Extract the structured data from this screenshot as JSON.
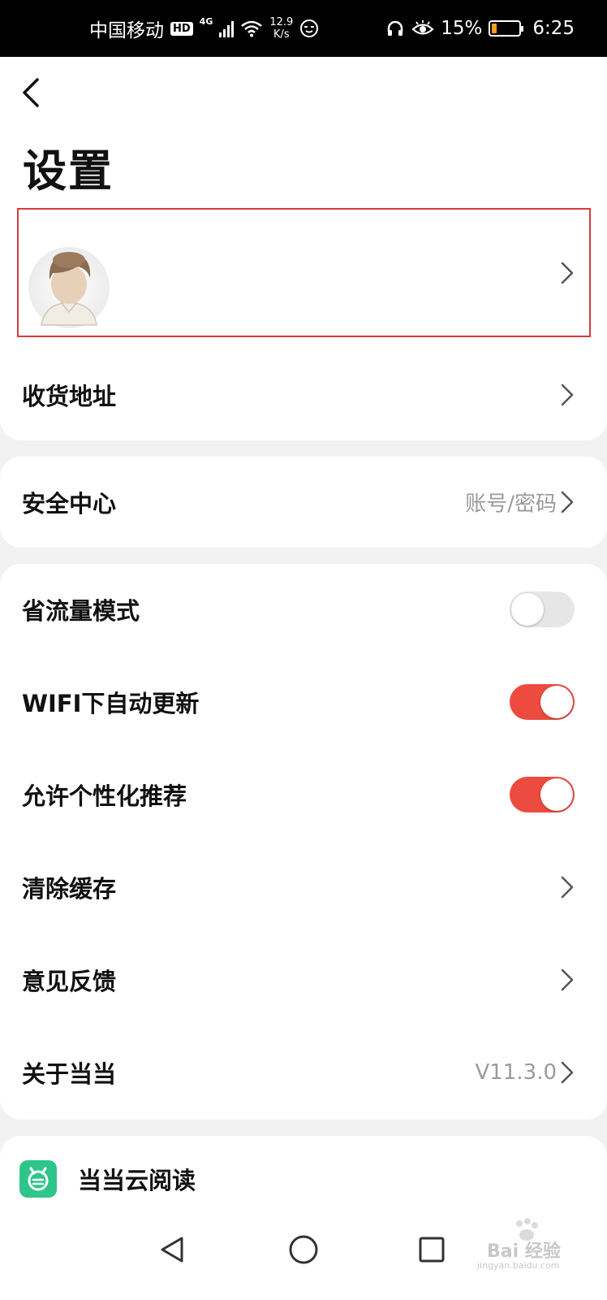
{
  "status_bar": {
    "carrier": "中国移动",
    "hd": "HD",
    "network": "4G",
    "speed_value": "12.9",
    "speed_unit": "K/s",
    "battery": "15%",
    "time": "6:25"
  },
  "header": {
    "title": "设置"
  },
  "rows": {
    "address": {
      "label": "收货地址"
    },
    "security": {
      "label": "安全中心",
      "value": "账号/密码"
    },
    "data_saver": {
      "label": "省流量模式",
      "enabled": false
    },
    "wifi_update": {
      "label": "WIFI下自动更新",
      "enabled": true
    },
    "personalized": {
      "label": "允许个性化推荐",
      "enabled": true
    },
    "clear_cache": {
      "label": "清除缓存"
    },
    "feedback": {
      "label": "意见反馈"
    },
    "about": {
      "label": "关于当当",
      "value": "V11.3.0"
    }
  },
  "app_promo": {
    "label": "当当云阅读",
    "icon_color": "#2ec58a"
  },
  "colors": {
    "accent": "#ee4b40",
    "highlight_border": "#d93a3a"
  },
  "watermark": {
    "brand": "Bai 经验",
    "url": "jingyan.baidu.com"
  }
}
